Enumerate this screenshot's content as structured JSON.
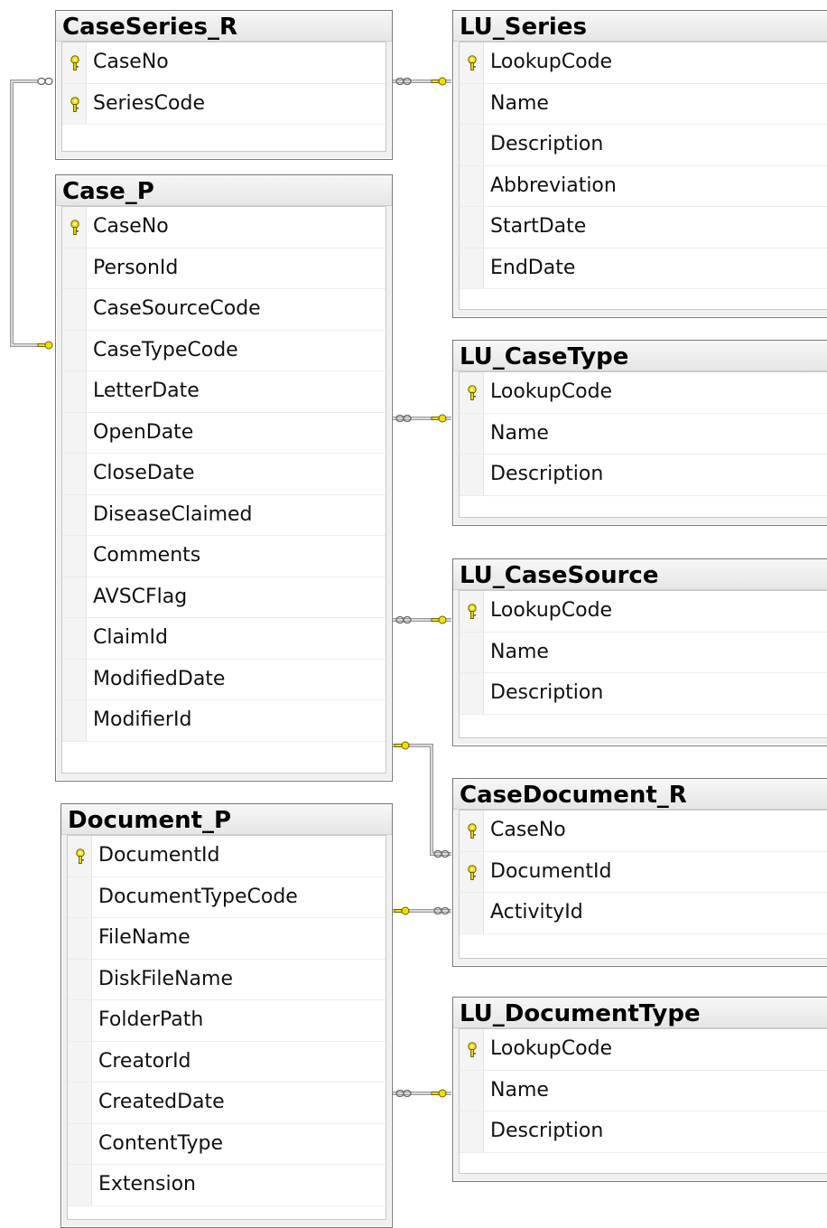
{
  "tables": {
    "caseseries_r": {
      "title": "CaseSeries_R",
      "columns": [
        {
          "name": "CaseNo",
          "pk": true
        },
        {
          "name": "SeriesCode",
          "pk": true
        }
      ]
    },
    "lu_series": {
      "title": "LU_Series",
      "columns": [
        {
          "name": "LookupCode",
          "pk": true
        },
        {
          "name": "Name",
          "pk": false
        },
        {
          "name": "Description",
          "pk": false
        },
        {
          "name": "Abbreviation",
          "pk": false
        },
        {
          "name": "StartDate",
          "pk": false
        },
        {
          "name": "EndDate",
          "pk": false
        }
      ]
    },
    "case_p": {
      "title": "Case_P",
      "columns": [
        {
          "name": "CaseNo",
          "pk": true
        },
        {
          "name": "PersonId",
          "pk": false
        },
        {
          "name": "CaseSourceCode",
          "pk": false
        },
        {
          "name": "CaseTypeCode",
          "pk": false
        },
        {
          "name": "LetterDate",
          "pk": false
        },
        {
          "name": "OpenDate",
          "pk": false
        },
        {
          "name": "CloseDate",
          "pk": false
        },
        {
          "name": "DiseaseClaimed",
          "pk": false
        },
        {
          "name": "Comments",
          "pk": false
        },
        {
          "name": "AVSCFlag",
          "pk": false
        },
        {
          "name": "ClaimId",
          "pk": false
        },
        {
          "name": "ModifiedDate",
          "pk": false
        },
        {
          "name": "ModifierId",
          "pk": false
        }
      ]
    },
    "lu_casetype": {
      "title": "LU_CaseType",
      "columns": [
        {
          "name": "LookupCode",
          "pk": true
        },
        {
          "name": "Name",
          "pk": false
        },
        {
          "name": "Description",
          "pk": false
        }
      ]
    },
    "lu_casesource": {
      "title": "LU_CaseSource",
      "columns": [
        {
          "name": "LookupCode",
          "pk": true
        },
        {
          "name": "Name",
          "pk": false
        },
        {
          "name": "Description",
          "pk": false
        }
      ]
    },
    "casedocument_r": {
      "title": "CaseDocument_R",
      "columns": [
        {
          "name": "CaseNo",
          "pk": true
        },
        {
          "name": "DocumentId",
          "pk": true
        },
        {
          "name": "ActivityId",
          "pk": false
        }
      ]
    },
    "document_p": {
      "title": "Document_P",
      "columns": [
        {
          "name": "DocumentId",
          "pk": true
        },
        {
          "name": "DocumentTypeCode",
          "pk": false
        },
        {
          "name": "FileName",
          "pk": false
        },
        {
          "name": "DiskFileName",
          "pk": false
        },
        {
          "name": "FolderPath",
          "pk": false
        },
        {
          "name": "CreatorId",
          "pk": false
        },
        {
          "name": "CreatedDate",
          "pk": false
        },
        {
          "name": "ContentType",
          "pk": false
        },
        {
          "name": "Extension",
          "pk": false
        }
      ]
    },
    "lu_documenttype": {
      "title": "LU_DocumentType",
      "columns": [
        {
          "name": "LookupCode",
          "pk": true
        },
        {
          "name": "Name",
          "pk": false
        },
        {
          "name": "Description",
          "pk": false
        }
      ]
    }
  },
  "colors": {
    "key_fill": "#f2e000",
    "key_stroke": "#6b6000",
    "line": "#9a9a9a"
  }
}
